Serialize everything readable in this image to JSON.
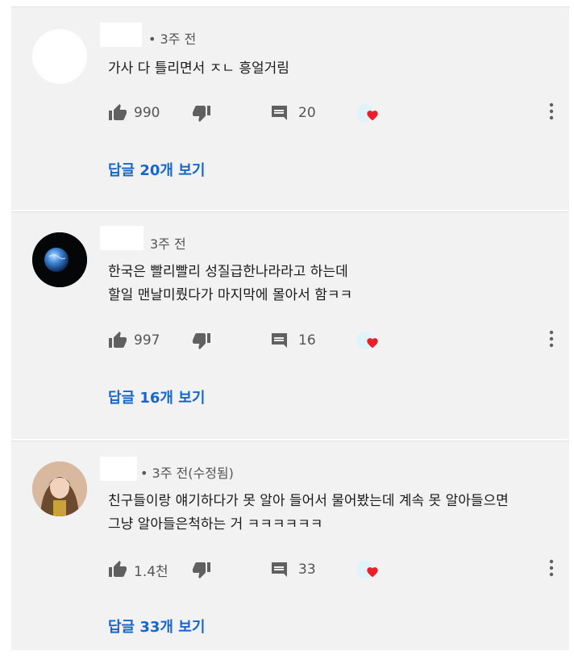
{
  "comments": [
    {
      "meta": "• 3주 전",
      "lines": [
        "가사 다 틀리면서 ㅈㄴ 흥얼거림"
      ],
      "likes": "990",
      "replies_count": "20",
      "replies_link": "답글 20개 보기"
    },
    {
      "meta": "3주 전",
      "lines": [
        "한국은 빨리빨리 성질급한나라라고 하는데",
        "할일 맨날미뤘다가 마지막에 몰아서 함ㅋㅋ"
      ],
      "likes": "997",
      "replies_count": "16",
      "replies_link": "답글 16개 보기"
    },
    {
      "meta": "• 3주 전(수정됨)",
      "lines": [
        "친구들이랑 얘기하다가 못 알아 들어서 물어봤는데 계속 못 알아들으면",
        "그냥 알아들은척하는 거 ㅋㅋㅋㅋㅋㅋ"
      ],
      "likes": "1.4천",
      "replies_count": "33",
      "replies_link": "답글 33개 보기"
    }
  ],
  "icons": {
    "like": "thumbs-up-icon",
    "dislike": "thumbs-down-icon",
    "reply": "comment-icon",
    "creator_heart": "creator-heart-icon",
    "more": "more-vert-icon"
  },
  "colors": {
    "card_background": "#f2f2f2",
    "link": "#1766c9",
    "text": "#1a1a1a",
    "secondary_text": "#555555",
    "icon": "#606060",
    "heart": "#e8202a"
  }
}
